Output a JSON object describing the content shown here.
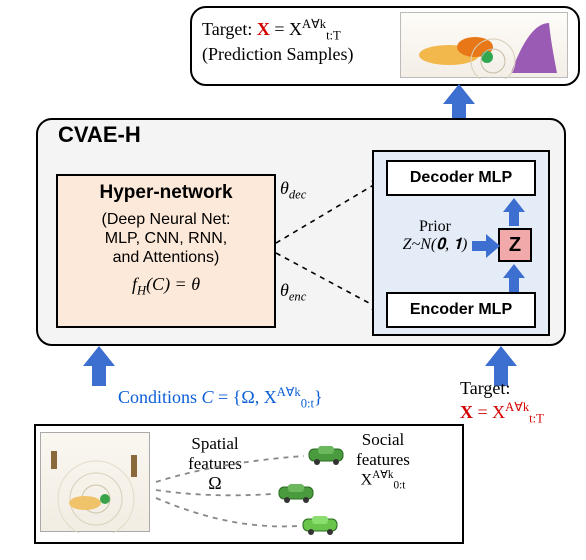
{
  "top": {
    "target_prefix": "Target: ",
    "target_x": "X",
    "target_eq": " = X",
    "target_sup": "A∀k",
    "target_sub": "t:T",
    "samples": "(Prediction Samples)"
  },
  "main": {
    "title": "CVAE-H"
  },
  "hyper": {
    "title": "Hyper-network",
    "sub": "(Deep Neural Net:\nMLP, CNN, RNN,\nand Attentions)",
    "fn": "f",
    "fn_sub": "H",
    "fn_arg": "(C) = θ"
  },
  "theta": {
    "dec": "θ",
    "dec_sub": "dec",
    "enc": "θ",
    "enc_sub": "enc"
  },
  "right": {
    "decoder": "Decoder MLP",
    "encoder": "Encoder MLP",
    "prior_label": "Prior",
    "prior_eq": "Z~N(𝟎, 𝟏)",
    "z": "Z"
  },
  "conditions": {
    "label": "Conditions ",
    "C": "C",
    "eq": " = {Ω, X",
    "sup": "A∀k",
    "sub": "0:t",
    "close": "}"
  },
  "target_in": {
    "prefix": "Target:",
    "x": "X",
    "eq": " = X",
    "sup": "A∀k",
    "sub": "t:T"
  },
  "bottom": {
    "spatial": "Spatial\nfeatures",
    "omega": "Ω",
    "social": "Social\nfeatures",
    "social_sym": "X",
    "social_sup": "A∀k",
    "social_sub": "0:t"
  }
}
